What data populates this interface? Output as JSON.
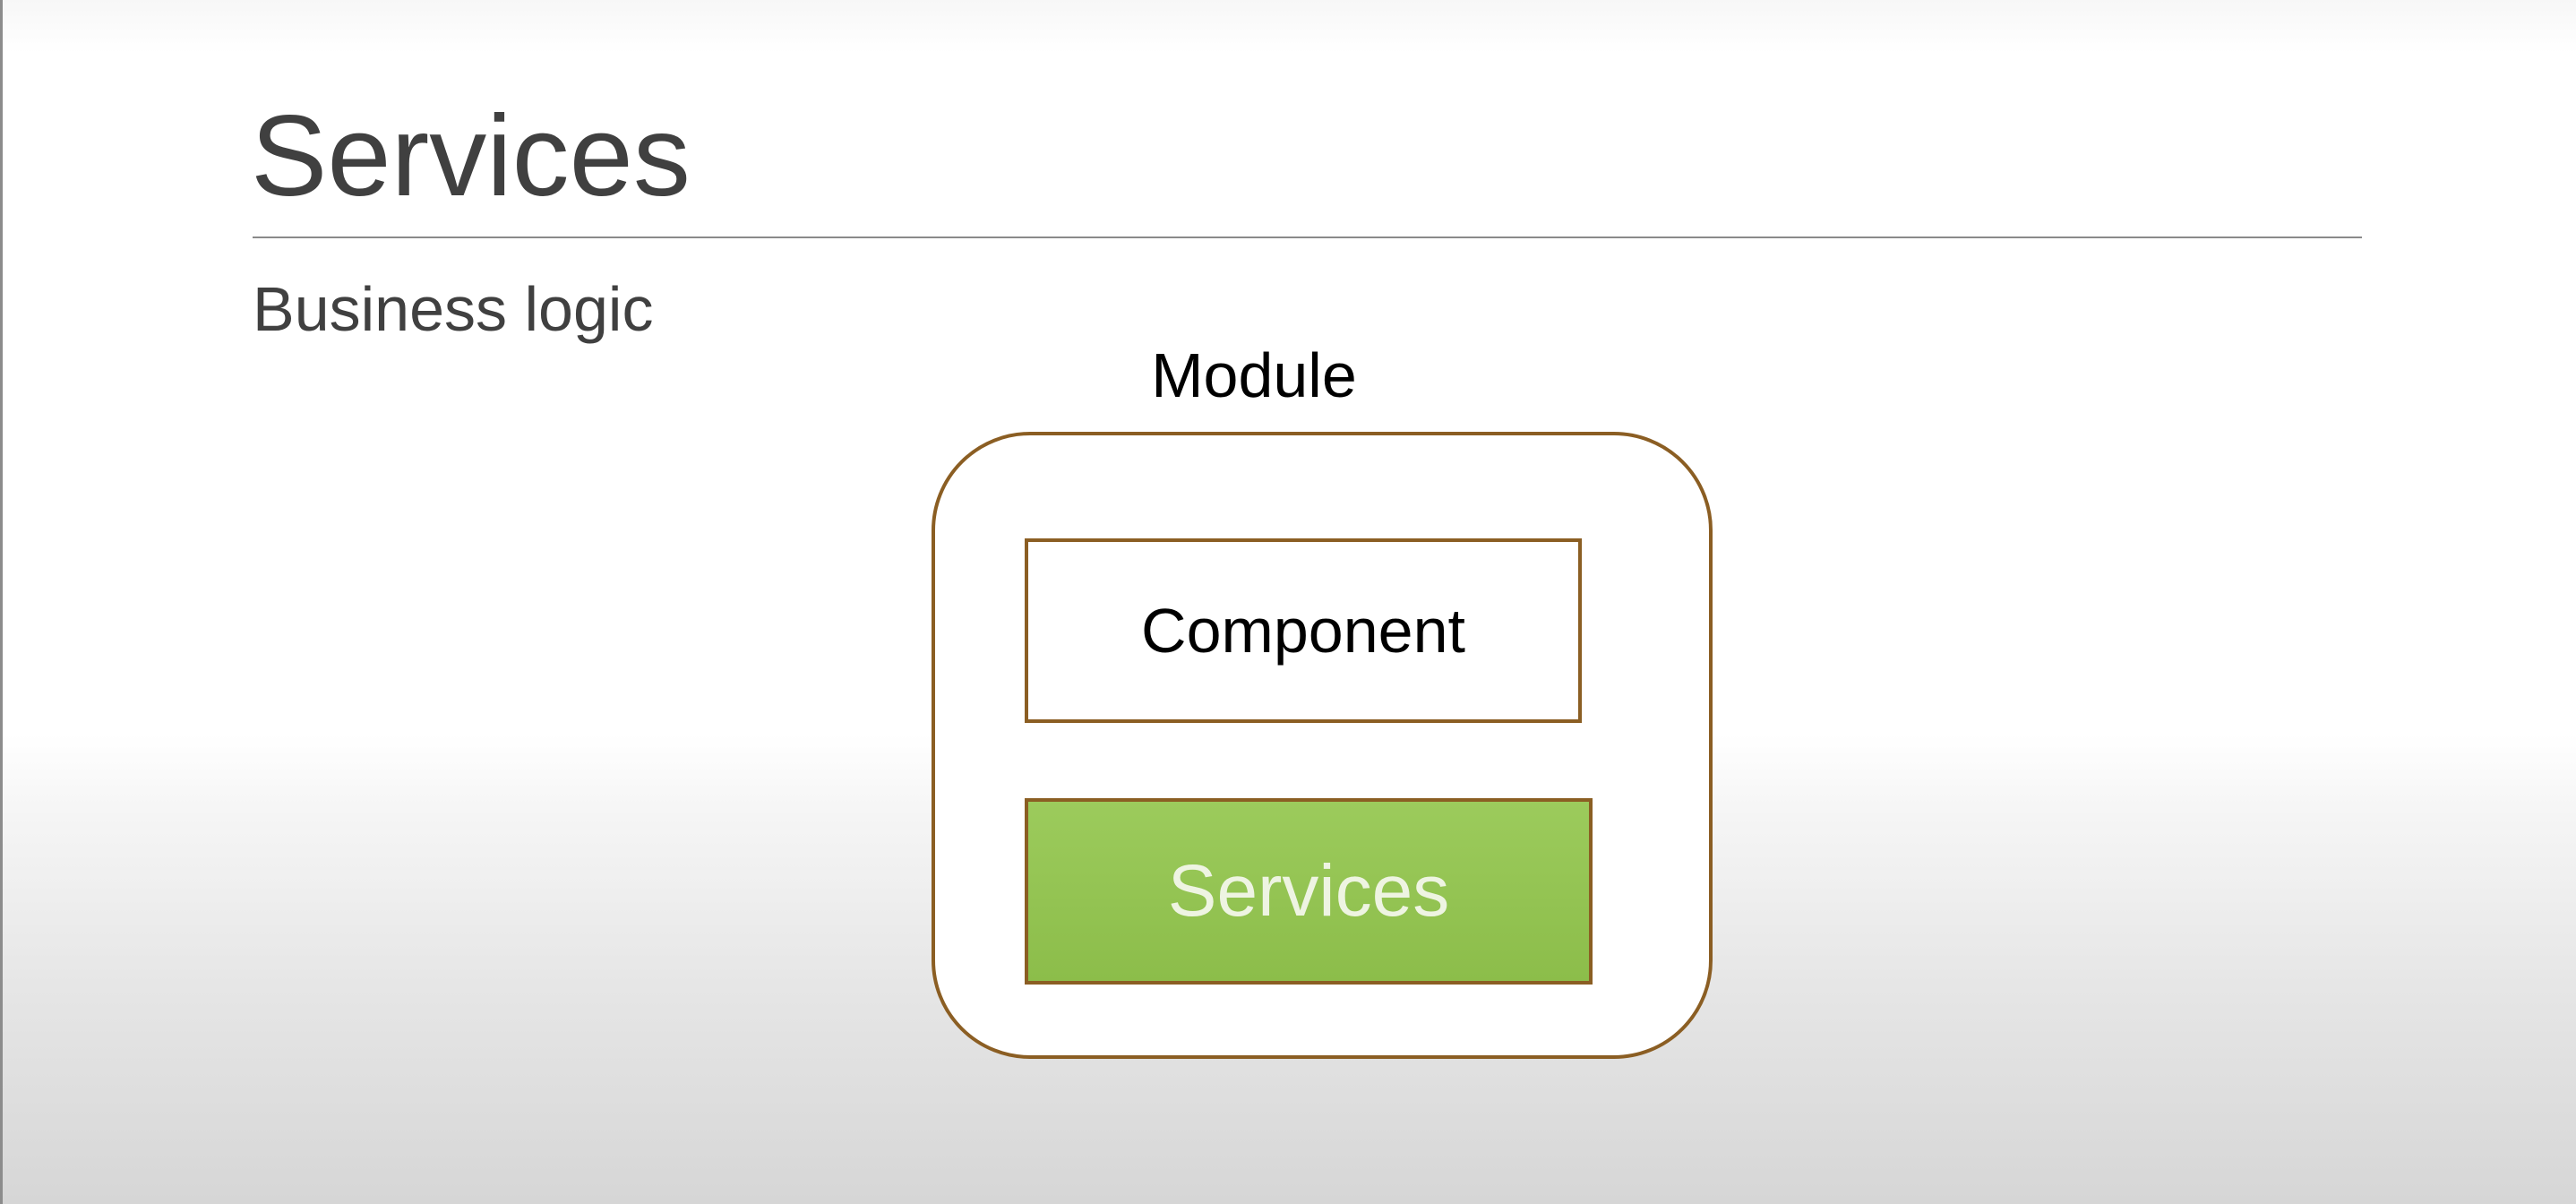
{
  "slide": {
    "title": "Services",
    "bullet": "Business logic"
  },
  "diagram": {
    "container_label": "Module",
    "inner_boxes": [
      {
        "label": "Component",
        "fill": "#ffffff"
      },
      {
        "label": "Services",
        "fill": "#94c452"
      }
    ],
    "border_color": "#8b5e23"
  }
}
